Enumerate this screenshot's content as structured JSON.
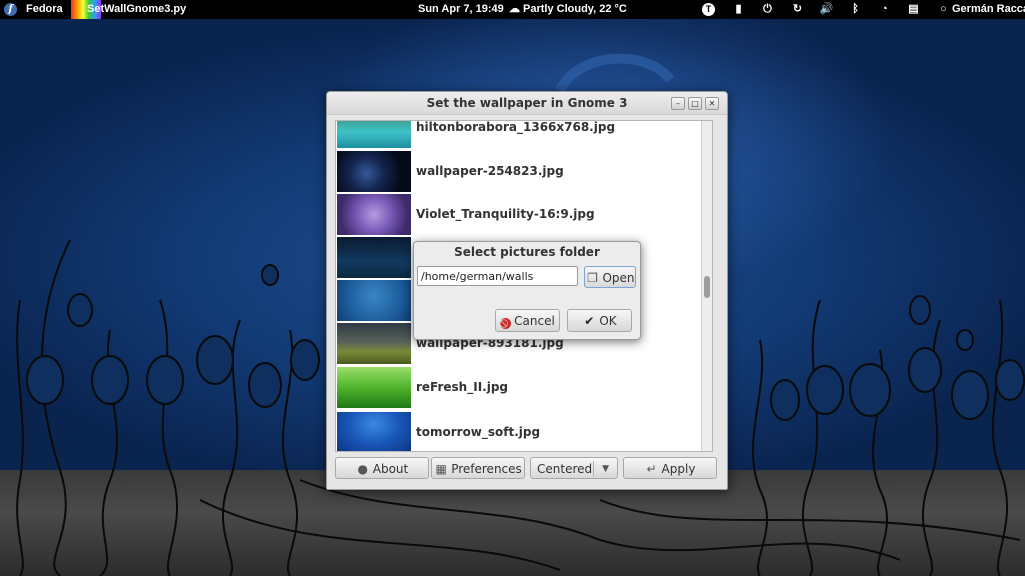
{
  "topbar": {
    "activities": "Fedora",
    "app_name": "SetWallGnome3.py",
    "clock": "Sun Apr  7, 19:49",
    "weather": "Partly Cloudy, 22 °C",
    "user": "Germán Racca",
    "tray_icons": [
      "text-input-icon",
      "folder-icon",
      "power-icon",
      "sync-icon",
      "volume-icon",
      "bluetooth-icon",
      "wifi-icon",
      "clipboard-icon"
    ]
  },
  "window": {
    "title": "Set the wallpaper in Gnome 3",
    "files": [
      "hiltonborabora_1366x768.jpg",
      "wallpaper-254823.jpg",
      "Violet_Tranquility-16:9.jpg",
      "",
      "",
      "wallpaper-893181.jpg",
      "reFresh_II.jpg",
      "tomorrow_soft.jpg"
    ],
    "buttons": {
      "about": "About",
      "preferences": "Preferences",
      "mode": "Centered",
      "apply": "Apply"
    }
  },
  "dialog": {
    "title": "Select pictures folder",
    "folder_path": "/home/german/walls",
    "open": "Open",
    "cancel": "Cancel",
    "ok": "OK"
  }
}
